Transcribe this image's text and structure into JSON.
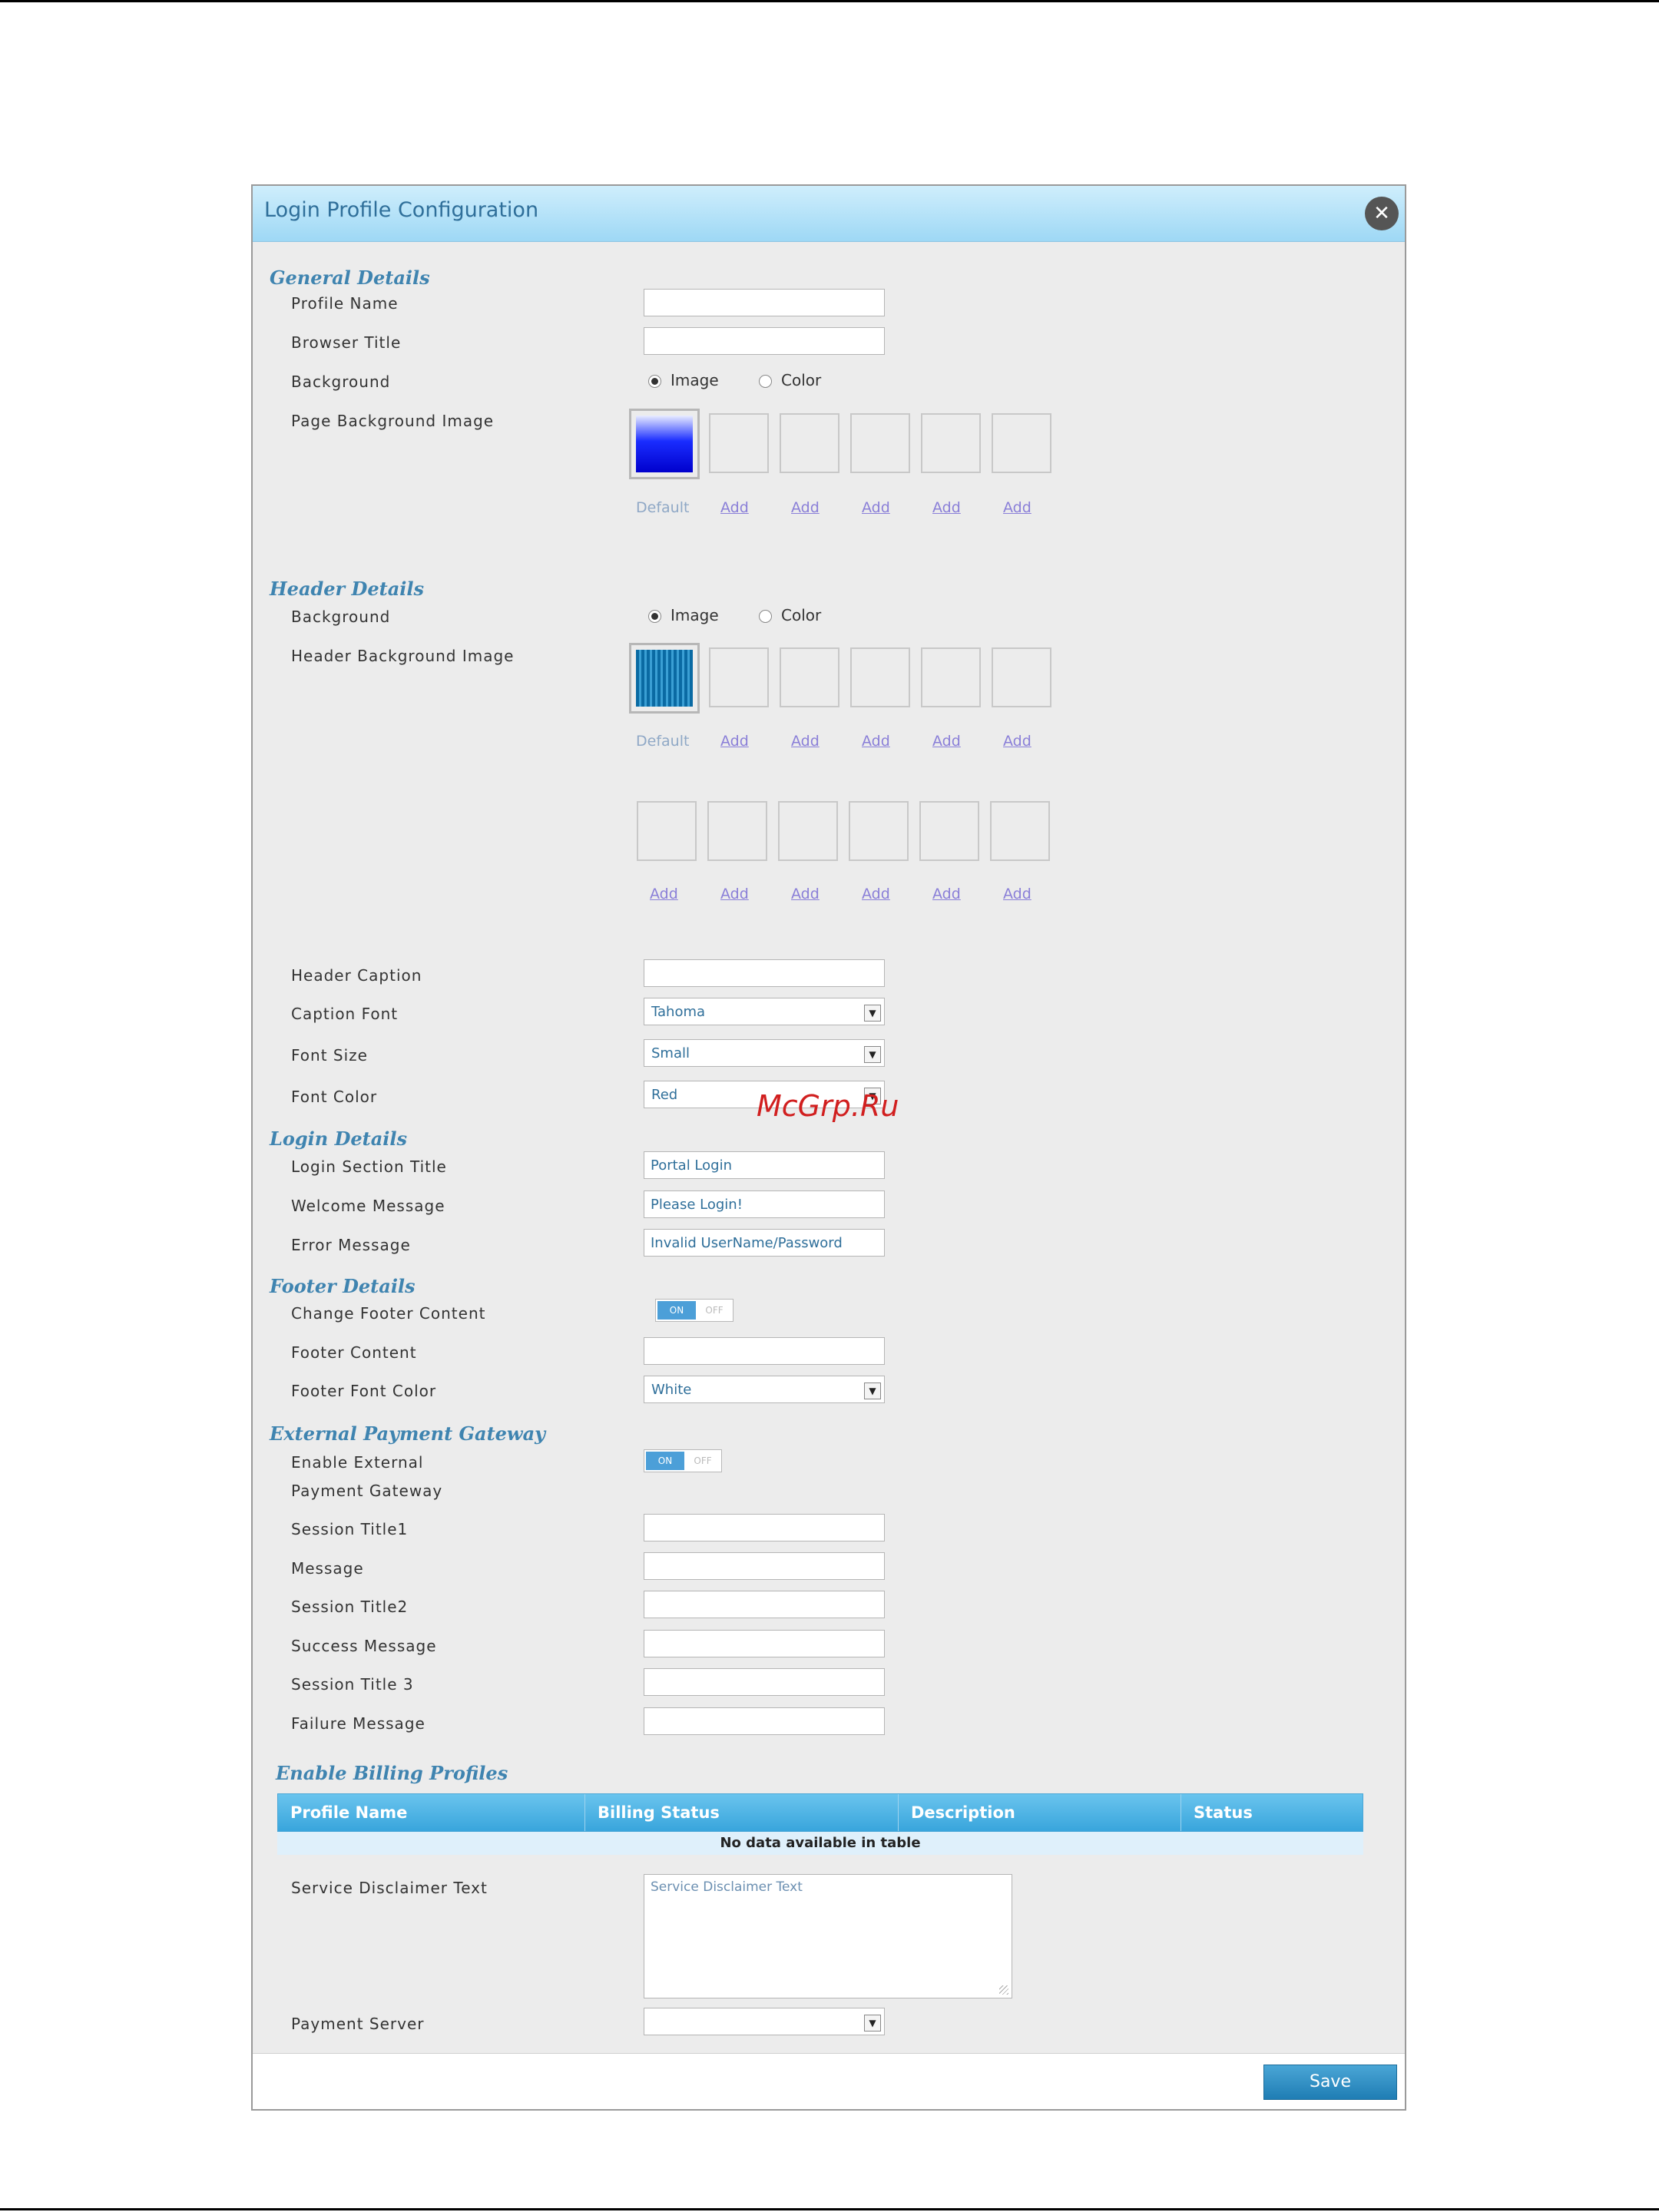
{
  "watermark": "McGrp.Ru",
  "dialog": {
    "title": "Login Profile Configuration",
    "close_glyph": "✕",
    "save_label": "Save"
  },
  "general": {
    "heading": "General Details",
    "profile_name_label": "Profile Name",
    "profile_name_value": "",
    "browser_title_label": "Browser Title",
    "browser_title_value": "",
    "background_label": "Background",
    "bg_option_image": "Image",
    "bg_option_color": "Color",
    "bg_selected": "Image",
    "page_bg_image_label": "Page Background Image",
    "thumb_links": [
      "Default",
      "Add",
      "Add",
      "Add",
      "Add",
      "Add"
    ]
  },
  "header": {
    "heading": "Header Details",
    "background_label": "Background",
    "bg_option_image": "Image",
    "bg_option_color": "Color",
    "bg_selected": "Image",
    "header_bg_image_label": "Header Background Image",
    "thumb_links_row1": [
      "Default",
      "Add",
      "Add",
      "Add",
      "Add",
      "Add"
    ],
    "thumb_links_row2": [
      "Add",
      "Add",
      "Add",
      "Add",
      "Add",
      "Add"
    ],
    "caption_label": "Header Caption",
    "caption_value": "",
    "caption_font_label": "Caption Font",
    "caption_font_value": "Tahoma",
    "font_size_label": "Font Size",
    "font_size_value": "Small",
    "font_color_label": "Font Color",
    "font_color_value": "Red"
  },
  "login": {
    "heading": "Login Details",
    "section_title_label": "Login Section Title",
    "section_title_value": "Portal Login",
    "welcome_label": "Welcome Message",
    "welcome_value": "Please Login!",
    "error_label": "Error Message",
    "error_value": "Invalid UserName/Password"
  },
  "footer": {
    "heading": "Footer Details",
    "change_content_label": "Change Footer Content",
    "toggle_on": "ON",
    "toggle_off": "OFF",
    "content_label": "Footer Content",
    "content_value": "",
    "font_color_label": "Footer Font Color",
    "font_color_value": "White"
  },
  "payment": {
    "heading": "External Payment Gateway",
    "enable_label_1": "Enable External",
    "enable_label_2": "Payment Gateway",
    "toggle_on": "ON",
    "toggle_off": "OFF",
    "fields": [
      {
        "label": "Session Title1",
        "value": ""
      },
      {
        "label": "Message",
        "value": ""
      },
      {
        "label": "Session Title2",
        "value": ""
      },
      {
        "label": "Success Message",
        "value": ""
      },
      {
        "label": "Session Title 3",
        "value": ""
      },
      {
        "label": "Failure Message",
        "value": ""
      }
    ]
  },
  "billing": {
    "heading": "Enable Billing Profiles",
    "columns": [
      "Profile Name",
      "Billing Status",
      "Description",
      "Status"
    ],
    "empty_text": "No data available in table",
    "disclaimer_label": "Service Disclaimer Text",
    "disclaimer_value": "Service Disclaimer Text",
    "payment_server_label": "Payment Server",
    "payment_server_value": ""
  },
  "colors": {
    "accent": "#3f84b0",
    "header_blue": "#9ed8f5",
    "button_blue": "#1f7db4",
    "watermark_red": "#d11f1f"
  }
}
